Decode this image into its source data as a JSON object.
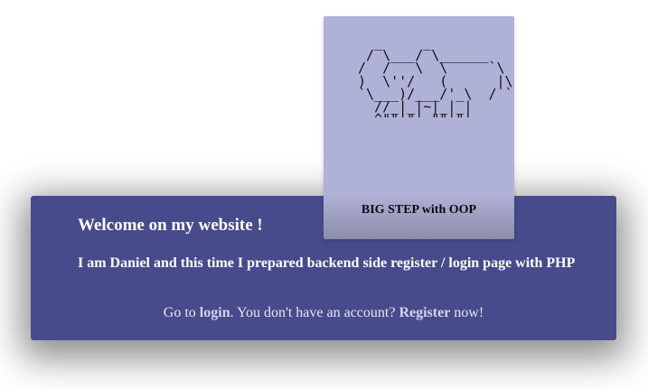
{
  "logo": {
    "ascii_art": "  _     _\n / \\___/ \\______\n/  /   \\  \\     `\\\n)  \\''/   (      |\\\n`\\___)/___/'_\\  / `\n  //_|_|~|_|_|\n  ^\"\"'\"' \"\"'\"'",
    "title": "BIG STEP with OOP"
  },
  "banner": {
    "welcome": "Welcome on my website !",
    "intro": "I am Daniel and this time I prepared backend side register / login page with PHP",
    "go_to_text": "Go to ",
    "login_link": "login",
    "no_account_text": ". You don't have an account? ",
    "register_link": "Register",
    "now_text": " now!"
  },
  "colors": {
    "banner_background": "#474b8b",
    "logo_card_background": "#b0b1d7",
    "link_color": "#d2d3ee"
  }
}
